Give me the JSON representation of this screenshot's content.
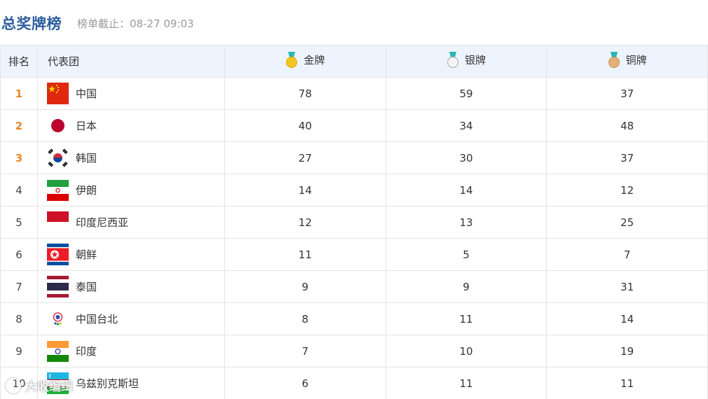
{
  "header": {
    "title": "总奖牌榜",
    "deadline": "榜单截止：08-27 09:03"
  },
  "table": {
    "columns": {
      "rank": "排名",
      "team": "代表团",
      "gold": "金牌",
      "silver": "银牌",
      "bronze": "铜牌"
    },
    "medal_icons": {
      "gold": "gold-medal-icon",
      "silver": "silver-medal-icon",
      "bronze": "bronze-medal-icon"
    },
    "rows": [
      {
        "rank": "1",
        "team": "中国",
        "flag": "china-flag-icon",
        "gold": "78",
        "silver": "59",
        "bronze": "37"
      },
      {
        "rank": "2",
        "team": "日本",
        "flag": "japan-flag-icon",
        "gold": "40",
        "silver": "34",
        "bronze": "48"
      },
      {
        "rank": "3",
        "team": "韩国",
        "flag": "korea-flag-icon",
        "gold": "27",
        "silver": "30",
        "bronze": "37"
      },
      {
        "rank": "4",
        "team": "伊朗",
        "flag": "iran-flag-icon",
        "gold": "14",
        "silver": "14",
        "bronze": "12"
      },
      {
        "rank": "5",
        "team": "印度尼西亚",
        "flag": "indonesia-flag-icon",
        "gold": "12",
        "silver": "13",
        "bronze": "25"
      },
      {
        "rank": "6",
        "team": "朝鲜",
        "flag": "north-korea-flag-icon",
        "gold": "11",
        "silver": "5",
        "bronze": "7"
      },
      {
        "rank": "7",
        "team": "泰国",
        "flag": "thailand-flag-icon",
        "gold": "9",
        "silver": "9",
        "bronze": "31"
      },
      {
        "rank": "8",
        "team": "中国台北",
        "flag": "chinese-taipei-flag-icon",
        "gold": "8",
        "silver": "11",
        "bronze": "14"
      },
      {
        "rank": "9",
        "team": "印度",
        "flag": "india-flag-icon",
        "gold": "7",
        "silver": "10",
        "bronze": "19"
      },
      {
        "rank": "10",
        "team": "乌兹别克斯坦",
        "flag": "uzbekistan-flag-icon",
        "gold": "6",
        "silver": "11",
        "bronze": "11"
      }
    ]
  },
  "colors": {
    "title": "#2f5f9e",
    "header_bg": "#eef4fd",
    "top_rank": "#e8892b",
    "gold": "#f3c623",
    "silver": "#d8d8d8",
    "bronze": "#e3b27a",
    "ribbon": "#29b5b5"
  },
  "watermark": {
    "text": "大收编缉"
  }
}
